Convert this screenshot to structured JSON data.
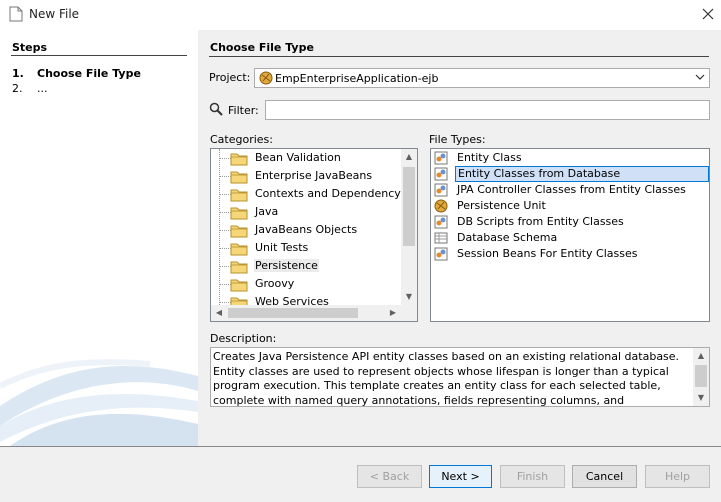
{
  "window": {
    "title": "New File"
  },
  "steps": {
    "header": "Steps",
    "items": [
      {
        "num": "1.",
        "label": "Choose File Type"
      },
      {
        "num": "2.",
        "label": "..."
      }
    ]
  },
  "main": {
    "title": "Choose File Type",
    "project_label": "Project:",
    "project_value": "EmpEnterpriseApplication-ejb",
    "filter_label": "Filter:",
    "filter_value": "",
    "categories_label": "Categories:",
    "categories": [
      "Bean Validation",
      "Enterprise JavaBeans",
      "Contexts and Dependency Inj",
      "Java",
      "JavaBeans Objects",
      "Unit Tests",
      "Persistence",
      "Groovy",
      "Web Services"
    ],
    "selected_category": "Persistence",
    "file_types_label": "File Types:",
    "file_types": [
      {
        "label": "Entity Class",
        "icon": "entity-class-icon"
      },
      {
        "label": "Entity Classes from Database",
        "icon": "entity-class-icon"
      },
      {
        "label": "JPA Controller Classes from Entity Classes",
        "icon": "entity-class-icon"
      },
      {
        "label": "Persistence Unit",
        "icon": "persistence-unit-icon"
      },
      {
        "label": "DB Scripts from Entity Classes",
        "icon": "entity-class-icon"
      },
      {
        "label": "Database Schema",
        "icon": "database-schema-icon"
      },
      {
        "label": "Session Beans For Entity Classes",
        "icon": "entity-class-icon"
      }
    ],
    "selected_file_type": "Entity Classes from Database",
    "description_label": "Description:",
    "description": "Creates Java Persistence API entity classes based on an existing relational database. Entity classes are used to represent objects whose lifespan is longer than a typical program execution. This template creates an entity class for each selected table, complete with named query annotations, fields representing columns, and relationships representing foreign keys."
  },
  "buttons": {
    "back": "< Back",
    "next": "Next >",
    "finish": "Finish",
    "cancel": "Cancel",
    "help": "Help"
  },
  "colors": {
    "selection_bg": "#cfe0f7",
    "selection_border": "#0078d7",
    "panel_bg": "#f0f0f0"
  }
}
